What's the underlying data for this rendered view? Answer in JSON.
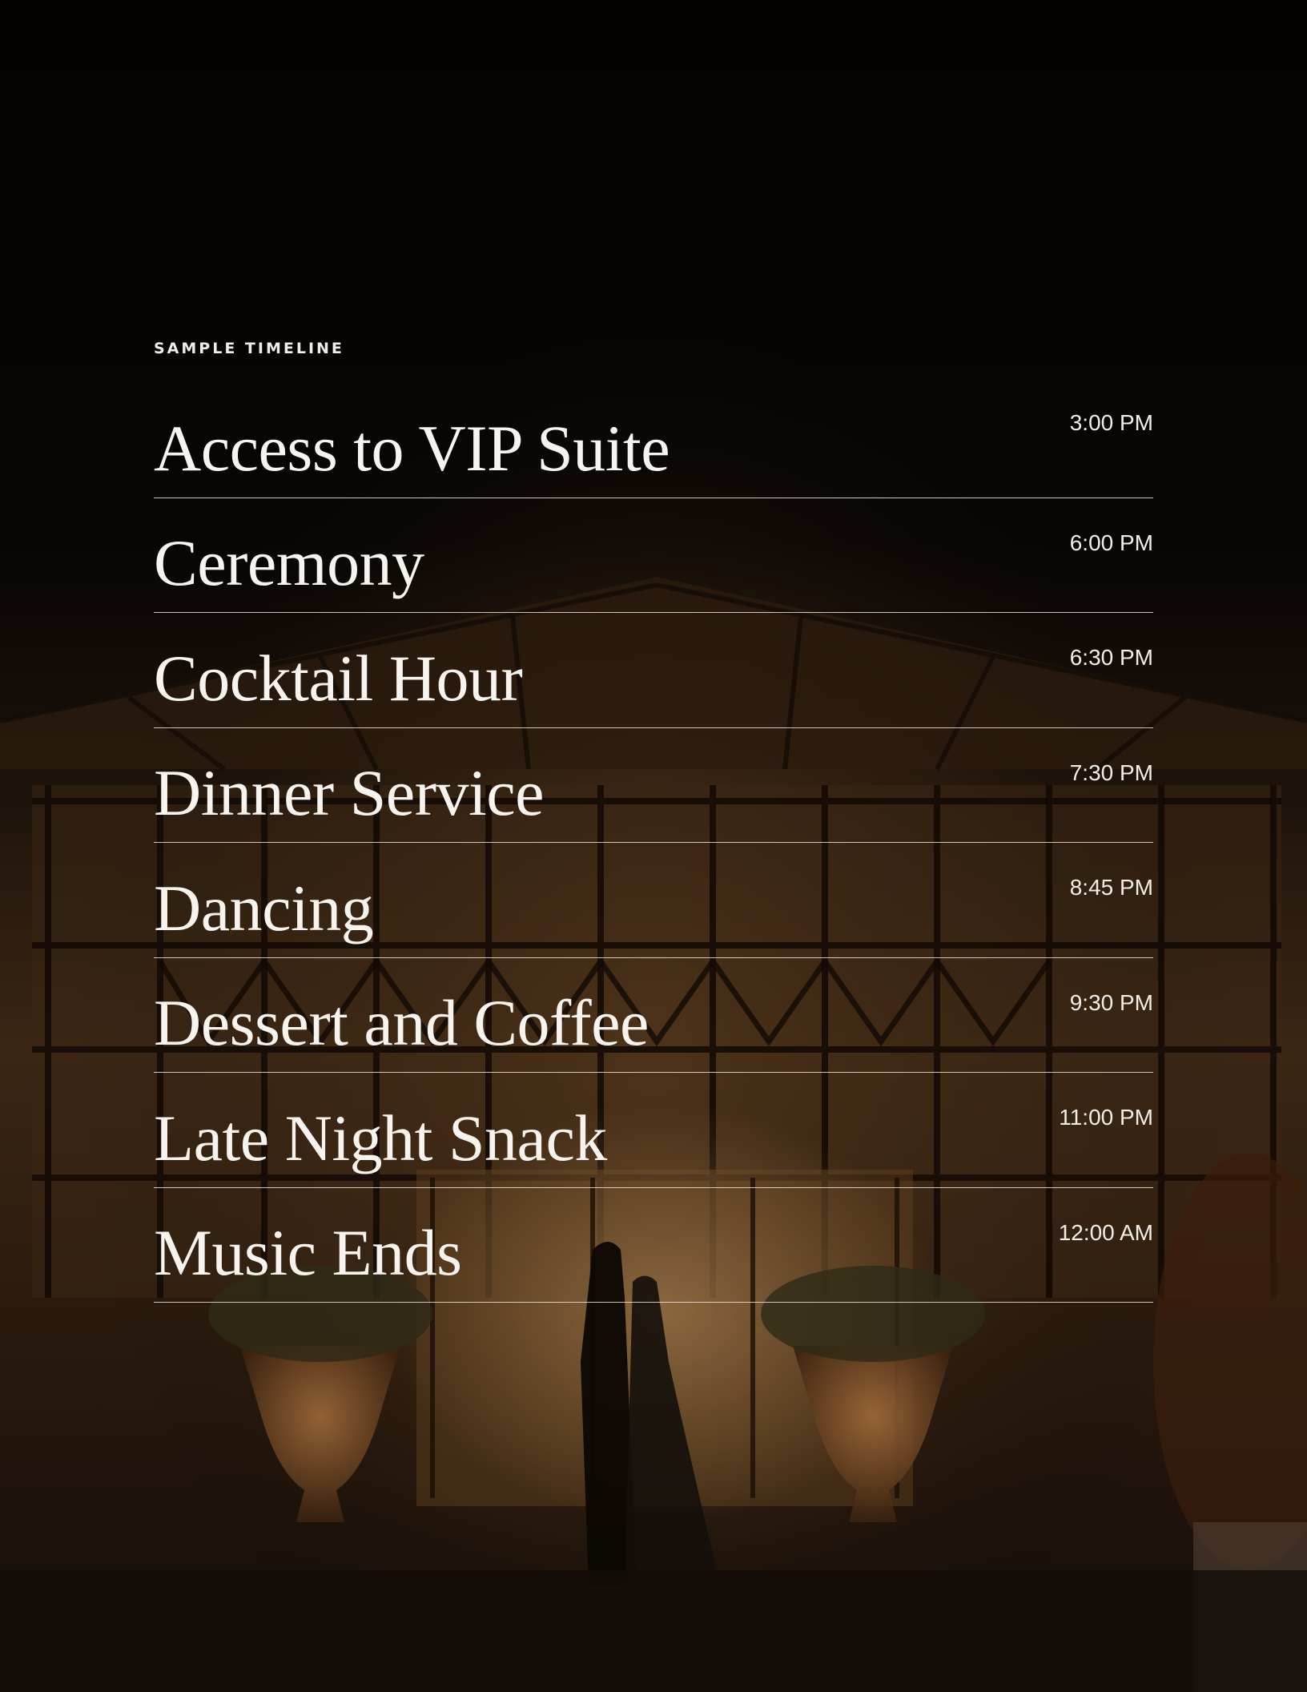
{
  "eyebrow": "SAMPLE TIMELINE",
  "timeline": [
    {
      "event": "Access to VIP Suite",
      "time": "3:00 PM"
    },
    {
      "event": "Ceremony",
      "time": "6:00 PM"
    },
    {
      "event": "Cocktail Hour",
      "time": "6:30 PM"
    },
    {
      "event": "Dinner Service",
      "time": "7:30 PM"
    },
    {
      "event": "Dancing",
      "time": "8:45 PM"
    },
    {
      "event": "Dessert and Coffee",
      "time": "9:30 PM"
    },
    {
      "event": "Late Night Snack",
      "time": "11:00 PM"
    },
    {
      "event": "Music Ends",
      "time": "12:00 AM"
    }
  ],
  "colors": {
    "background": "#060403",
    "text": "#f7f3ee",
    "divider": "#ebe4dc",
    "warm_light": "#b07a3e"
  }
}
